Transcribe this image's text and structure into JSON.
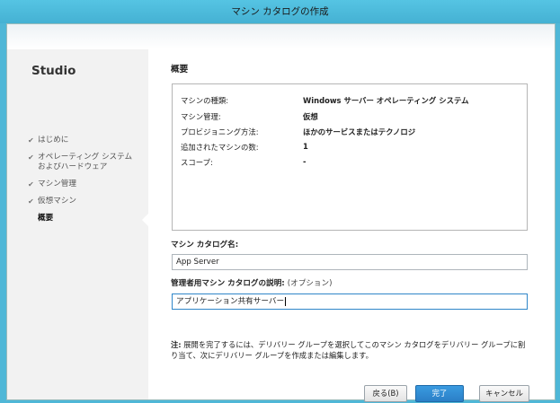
{
  "window": {
    "title": "マシン カタログの作成"
  },
  "sidebar": {
    "brand": "Studio",
    "steps": [
      {
        "label": "はじめに",
        "done": true
      },
      {
        "label": "オペレーティング システム\nおよびハードウェア",
        "done": true
      },
      {
        "label": "マシン管理",
        "done": true
      },
      {
        "label": "仮想マシン",
        "done": true
      },
      {
        "label": "概要",
        "done": false,
        "current": true
      }
    ]
  },
  "main": {
    "section_title": "概要",
    "summary": [
      {
        "key": "マシンの種類:",
        "value": "Windows サーバー オペレーティング システム"
      },
      {
        "key": "マシン管理:",
        "value": "仮想"
      },
      {
        "key": "プロビジョニング方法:",
        "value": "ほかのサービスまたはテクノロジ"
      },
      {
        "key": "追加されたマシンの数:",
        "value": "1"
      },
      {
        "key": "スコープ:",
        "value": "-"
      }
    ],
    "catalog_name_label": "マシン カタログ名:",
    "catalog_name_value": "App Server",
    "description_label": "管理者用マシン カタログの説明:",
    "description_optional": "(オプション)",
    "description_value": "アプリケーション共有サーバー",
    "note_prefix": "注:",
    "note_text": " 展開を完了するには、デリバリー グループを選択してこのマシン カタログをデリバリー グループに割り当て、次にデリバリー グループを作成または編集します。"
  },
  "buttons": {
    "back": "戻る(B)",
    "finish": "完了",
    "cancel": "キャンセル"
  },
  "colors": {
    "titlebar": "#4fb7d7",
    "primary_button": "#2b7fc7",
    "sidebar_bg": "#f2f2f2"
  }
}
